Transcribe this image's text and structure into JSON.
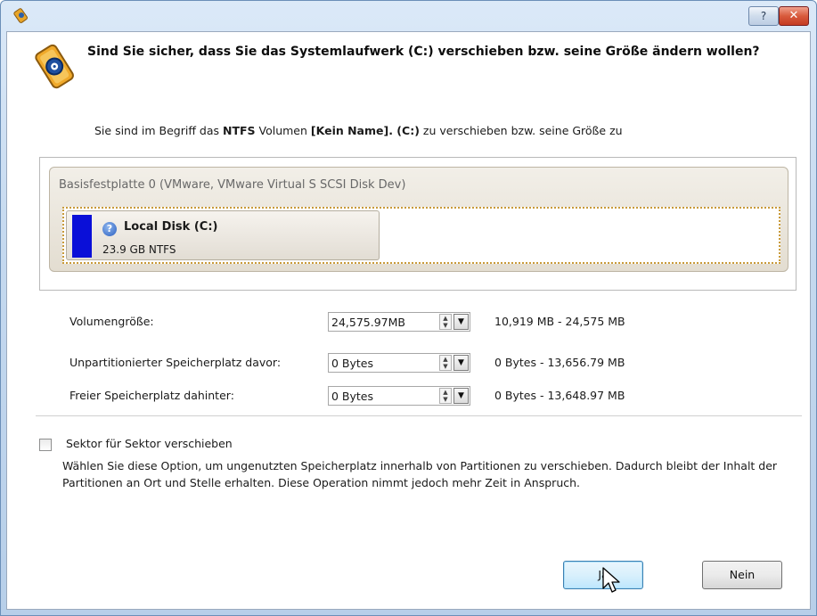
{
  "dialog": {
    "heading": "Sind Sie sicher, dass Sie das Systemlaufwerk (C:) verschieben bzw. seine Größe ändern wollen?",
    "sub": {
      "p1": "Sie sind im Begriff das ",
      "fs": "NTFS",
      "p2": " Volumen ",
      "name": "[Kein Name]. (C:)",
      "p3": " zu verschieben bzw. seine Größe zu"
    },
    "titlebar": {
      "help_label": "?",
      "close_label": "✕"
    }
  },
  "disk": {
    "title": "Basisfestplatte 0 (VMware, VMware Virtual S SCSI Disk Dev)",
    "partition": {
      "name": "Local Disk (C:)",
      "size": "23.9 GB NTFS",
      "color": "#0a0fd8",
      "usage_icon": "?"
    }
  },
  "fields": [
    {
      "label": "Volumengröße:",
      "value": "24,575.97MB",
      "range": "10,919 MB - 24,575 MB"
    },
    {
      "label": "Unpartitionierter Speicherplatz davor:",
      "value": "0 Bytes",
      "range": "0 Bytes - 13,656.79 MB"
    },
    {
      "label": "Freier Speicherplatz dahinter:",
      "value": "0 Bytes",
      "range": "0 Bytes - 13,648.97 MB"
    }
  ],
  "option": {
    "label": "Sektor für Sektor verschieben",
    "description": "Wählen Sie diese Option, um ungenutzten Speicherplatz innerhalb von Partitionen zu verschieben. Dadurch bleibt der Inhalt der Partitionen an Ort und Stelle erhalten. Diese Operation nimmt jedoch mehr Zeit in Anspruch.",
    "checked": false
  },
  "buttons": {
    "yes": "Ja",
    "no": "Nein"
  },
  "colors": {
    "accent": "#3c7fb1",
    "partition": "#0a0fd8",
    "close": "#c43b22"
  }
}
